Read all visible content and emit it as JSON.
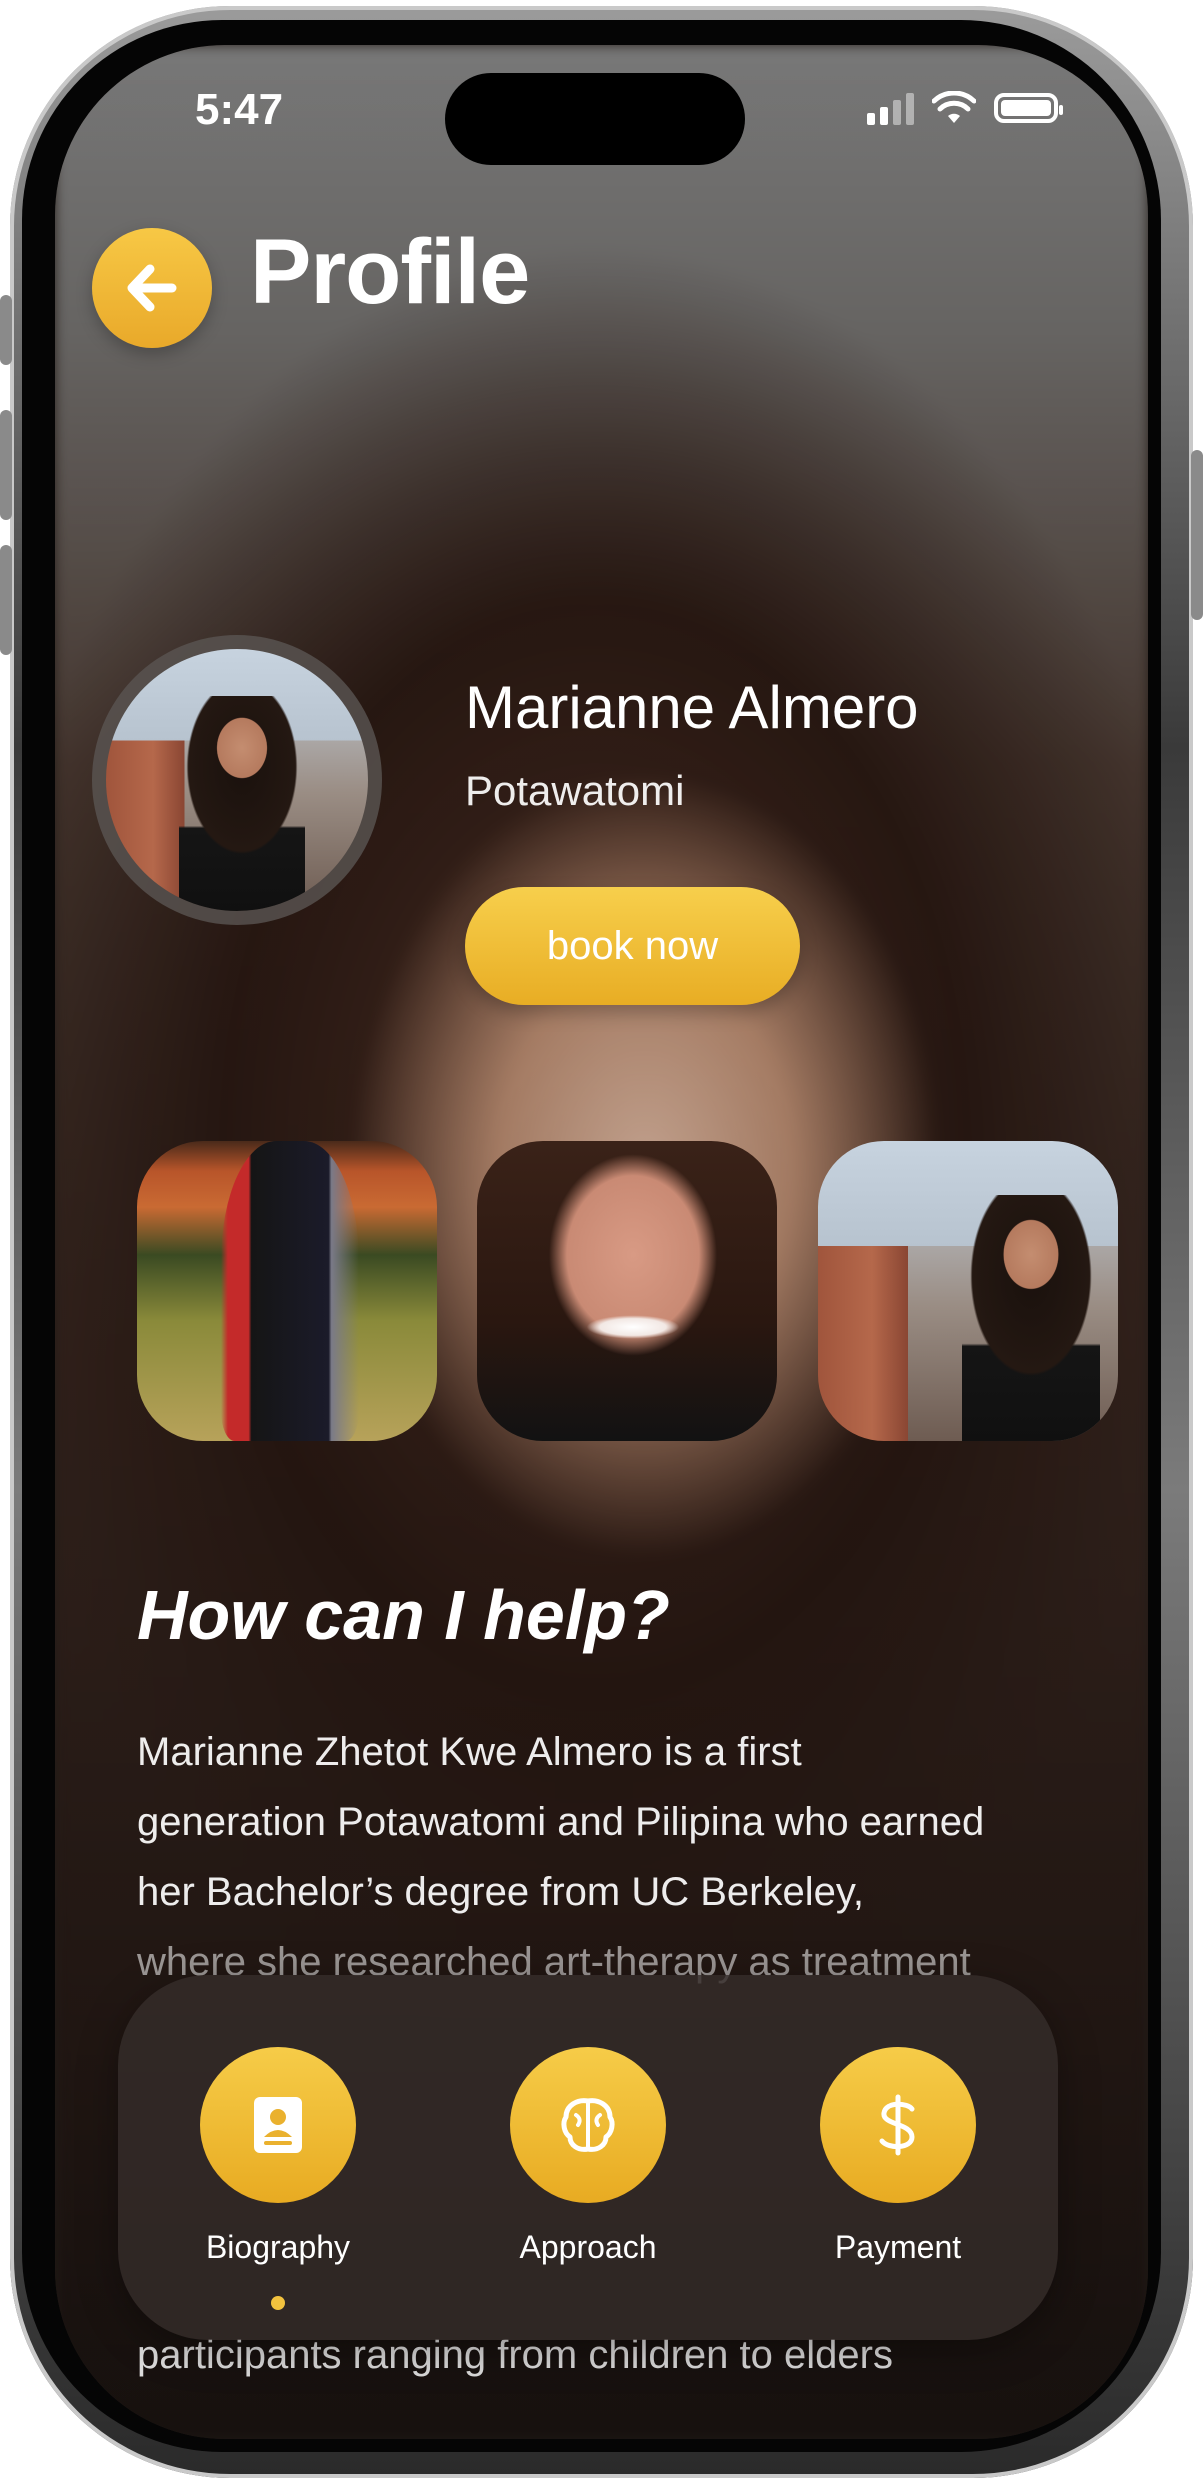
{
  "status_bar": {
    "time": "5:47"
  },
  "header": {
    "back_icon": "arrow-left-icon",
    "title": "Profile"
  },
  "profile": {
    "name": "Marianne Almero",
    "tribe": "Potawatomi",
    "book_label": "book now"
  },
  "section": {
    "title": "How can I help?"
  },
  "bio": {
    "line1": "Marianne Zhetot Kwe Almero is a first",
    "line2": "generation Potawatomi and Pilipina who earned",
    "line3": "her Bachelor’s degree from UC Berkeley,",
    "line4": "where she researched art-therapy as treatment",
    "tail": "participants ranging from children to elders"
  },
  "bottom_nav": {
    "tabs": [
      {
        "label": "Biography",
        "icon": "contact-book-icon"
      },
      {
        "label": "Approach",
        "icon": "brain-icon"
      },
      {
        "label": "Payment",
        "icon": "dollar-icon"
      }
    ],
    "active_index": 0
  },
  "colors": {
    "accent": "#F2BE3A",
    "text": "#FFFFFF"
  }
}
